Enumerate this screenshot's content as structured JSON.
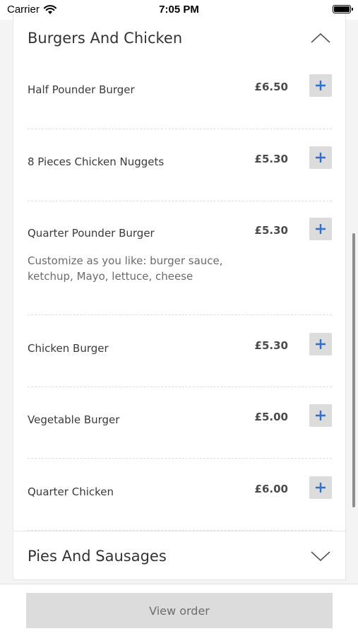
{
  "status_bar": {
    "carrier": "Carrier",
    "time": "7:05 PM"
  },
  "sections": [
    {
      "title": "Burgers And Chicken",
      "expanded": true,
      "chevron_icon": "chevron-up-icon"
    },
    {
      "title": "Pies And Sausages",
      "expanded": false,
      "chevron_icon": "chevron-down-icon"
    }
  ],
  "items": [
    {
      "name": "Half Pounder Burger",
      "price": "£6.50",
      "description": ""
    },
    {
      "name": "8 Pieces Chicken Nuggets",
      "price": "£5.30",
      "description": ""
    },
    {
      "name": "Quarter Pounder Burger",
      "price": "£5.30",
      "description": "Customize as you like: burger sauce, ketchup, Mayo, lettuce, cheese"
    },
    {
      "name": "Chicken Burger",
      "price": "£5.30",
      "description": ""
    },
    {
      "name": "Vegetable Burger",
      "price": "£5.00",
      "description": ""
    },
    {
      "name": "Quarter Chicken",
      "price": "£6.00",
      "description": ""
    }
  ],
  "add_icon": "plus-icon",
  "colors": {
    "accent": "#2f6fd0",
    "button_bg": "#dcdcdc"
  },
  "footer": {
    "view_order_label": "View order"
  }
}
